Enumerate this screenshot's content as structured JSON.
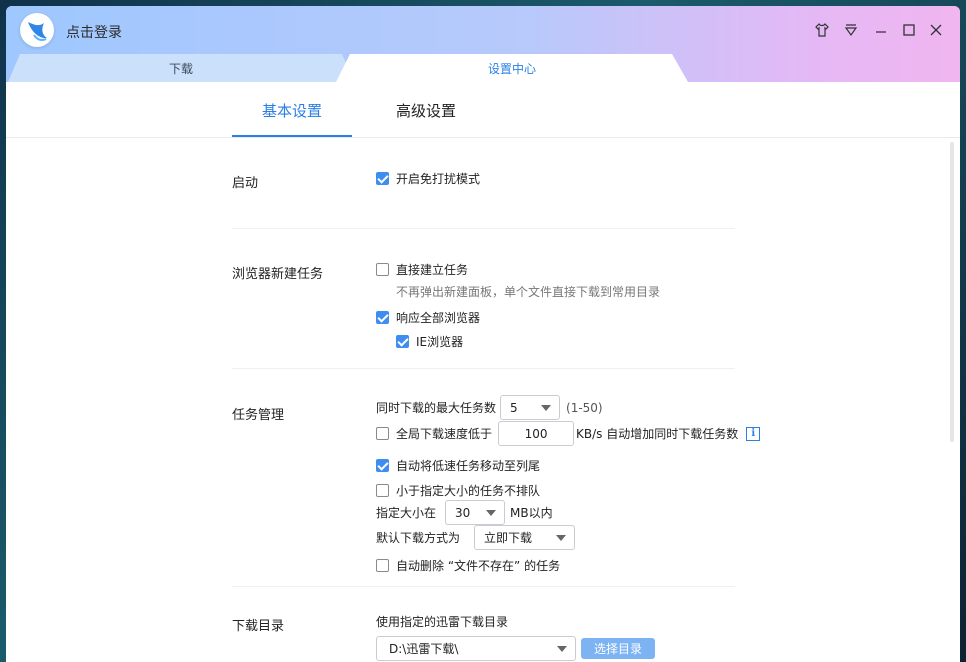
{
  "titlebar": {
    "login_text": "点击登录",
    "icons": [
      "logo-icon",
      "skin-icon",
      "menu-icon",
      "minimize-icon",
      "maximize-icon",
      "close-icon"
    ]
  },
  "main_tabs": [
    {
      "label": "下载",
      "active": false
    },
    {
      "label": "设置中心",
      "active": true
    }
  ],
  "sub_tabs": [
    {
      "label": "基本设置",
      "active": true
    },
    {
      "label": "高级设置",
      "active": false
    }
  ],
  "startup": {
    "section_label": "启动",
    "do_not_disturb": {
      "label": "开启免打扰模式",
      "checked": true
    }
  },
  "browser_tasks": {
    "section_label": "浏览器新建任务",
    "direct_create": {
      "label": "直接建立任务",
      "checked": false,
      "hint": "不再弹出新建面板，单个文件直接下载到常用目录"
    },
    "respond_all": {
      "label": "响应全部浏览器",
      "checked": true
    },
    "ie": {
      "label": "IE浏览器",
      "checked": true
    }
  },
  "task_management": {
    "section_label": "任务管理",
    "max_tasks": {
      "label": "同时下载的最大任务数",
      "value": "5",
      "range": "(1-50)"
    },
    "low_speed": {
      "label": "全局下载速度低于",
      "checked": false,
      "value": "100",
      "suffix": "KB/s 自动增加同时下载任务数"
    },
    "move_slow": {
      "label": "自动将低速任务移动至列尾",
      "checked": true
    },
    "small_no_queue": {
      "label": "小于指定大小的任务不排队",
      "checked": false
    },
    "size_limit": {
      "label": "指定大小在",
      "value": "30",
      "suffix": "MB以内"
    },
    "default_mode": {
      "label": "默认下载方式为",
      "value": "立即下载"
    },
    "auto_delete": {
      "label": "自动删除 “文件不存在” 的任务",
      "checked": false
    }
  },
  "download_dir": {
    "section_label": "下载目录",
    "use_specified": "使用指定的迅雷下载目录",
    "path": "D:\\迅雷下载\\",
    "choose_button": "选择目录"
  },
  "colors": {
    "accent": "#2a7fe6",
    "checkbox": "#3d8ef0",
    "button": "#7db3f3",
    "titlebar_left": "#9ec8ff",
    "titlebar_right": "#f0b6f0"
  }
}
